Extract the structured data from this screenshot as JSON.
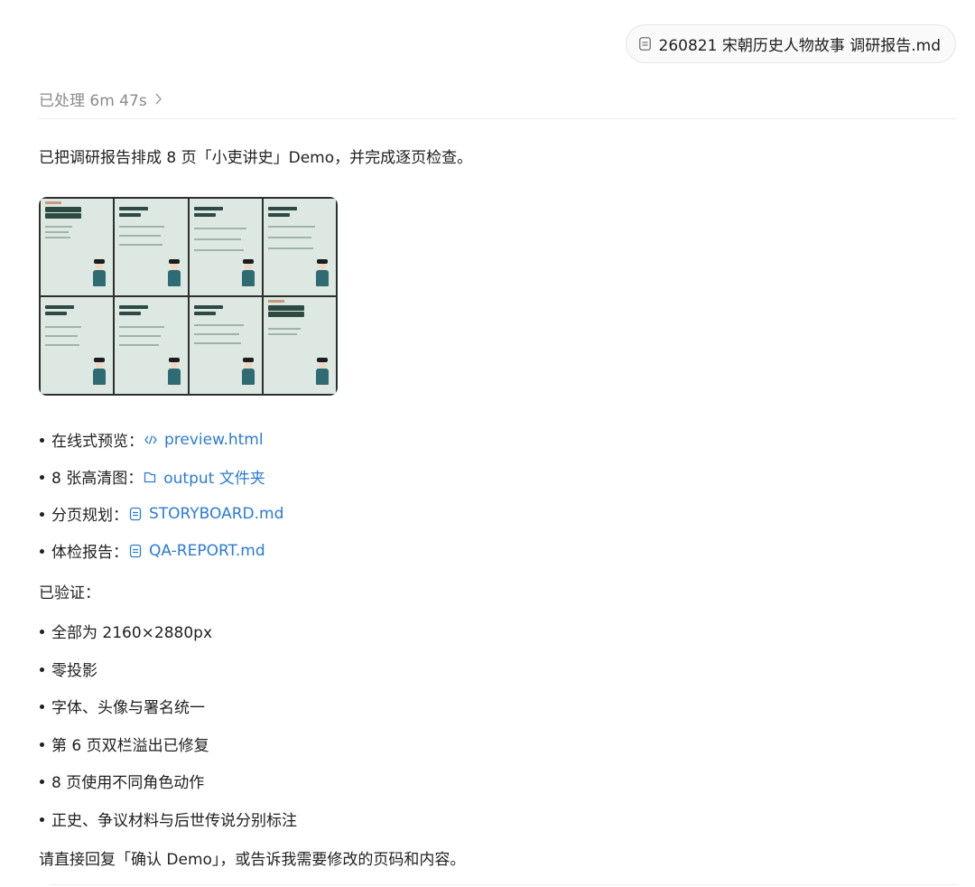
{
  "file_chip": {
    "name": "260821 宋朝历史人物故事 调研报告.md",
    "icon": "document-icon"
  },
  "status": {
    "label": "已处理 6m 47s",
    "icon": "chevron-right-icon"
  },
  "intro": "已把调研报告排成 8 页「小吏讲史」Demo，并完成逐页检查。",
  "thumbnail": {
    "slides": 8,
    "background": "#dde8e2",
    "accent": "#2d4a43"
  },
  "deliverables": [
    {
      "label": "在线式预览：",
      "link": "preview.html",
      "icon": "code-icon"
    },
    {
      "label": "8 张高清图：",
      "link": "output 文件夹",
      "icon": "folder-icon"
    },
    {
      "label": "分页规划：",
      "link": "STORYBOARD.md",
      "icon": "document-icon"
    },
    {
      "label": "体检报告：",
      "link": "QA-REPORT.md",
      "icon": "document-icon"
    }
  ],
  "verified_heading": "已验证：",
  "verified": [
    "全部为 2160×2880px",
    "零投影",
    "字体、头像与署名统一",
    "第 6 页双栏溢出已修复",
    "8 页使用不同角色动作",
    "正史、争议材料与后世传说分别标注"
  ],
  "closing": "请直接回复「确认 Demo」，或告诉我需要修改的页码和内容。",
  "colors": {
    "link": "#2b7bd6",
    "muted": "#8a8a8a",
    "text": "#1f1f1f"
  }
}
